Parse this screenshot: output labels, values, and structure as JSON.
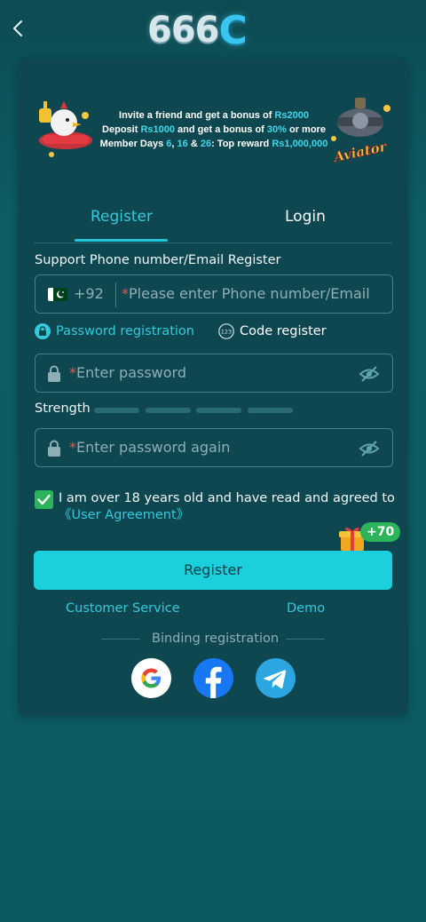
{
  "header": {
    "logo_text": "666",
    "logo_c": "C"
  },
  "promo": {
    "line1_pre": "Invite a friend and get a bonus of ",
    "line1_hl": "Rs2000",
    "line2_a": "Deposit ",
    "line2_hl1": "Rs1000",
    "line2_b": " and get a bonus of ",
    "line2_hl2": "30%",
    "line2_c": " or more",
    "line3_a": "Member Days ",
    "line3_hl1": "6",
    "line3_b": ", ",
    "line3_hl2": "16",
    "line3_c": " & ",
    "line3_hl3": "26",
    "line3_d": ": Top reward ",
    "line3_hl4": "Rs1,000,000",
    "aviator_label": "Aviator"
  },
  "tabs": {
    "register": "Register",
    "login": "Login"
  },
  "form": {
    "section_label": "Support Phone number/Email Register",
    "country_code": "+92",
    "phone_placeholder": "Please enter Phone number/Email",
    "required_mark": "*",
    "option_password": "Password registration",
    "option_code": "Code register",
    "password_placeholder": "Enter password",
    "password_again_placeholder": "Enter password again",
    "strength_label": "Strength",
    "agree_text": "I am over 18 years old and have read and agreed to",
    "agreement_link": "《User Agreement》",
    "gift_badge": "+70",
    "register_button": "Register"
  },
  "links": {
    "customer_service": "Customer Service",
    "demo": "Demo"
  },
  "binding": {
    "label": "Binding registration"
  },
  "colors": {
    "accent": "#1ccfdc",
    "link": "#35c9dc",
    "check": "#2bb45a",
    "card": "#0f4750"
  }
}
